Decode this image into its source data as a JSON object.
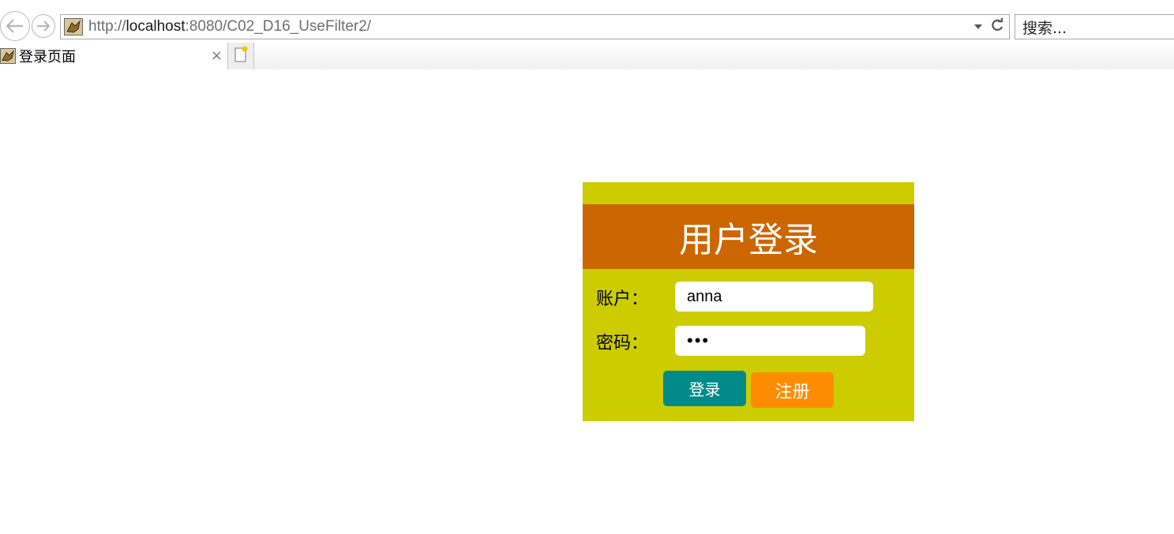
{
  "browser": {
    "url_prefix": "http://",
    "url_host": "localhost",
    "url_rest": ":8080/C02_D16_UseFilter2/",
    "search_placeholder": "搜索...",
    "tab_title": "登录页面",
    "tab_close": "×"
  },
  "login": {
    "title": "用户登录",
    "username_label": "账户：",
    "username_value": "anna",
    "password_label": "密码：",
    "password_value": "•••",
    "login_button": "登录",
    "register_button": "注册"
  },
  "colors": {
    "panel_bg": "#cccc00",
    "header_bg": "#cc6600",
    "login_button_bg": "#008b8b",
    "register_button_bg": "#ff8c00"
  }
}
